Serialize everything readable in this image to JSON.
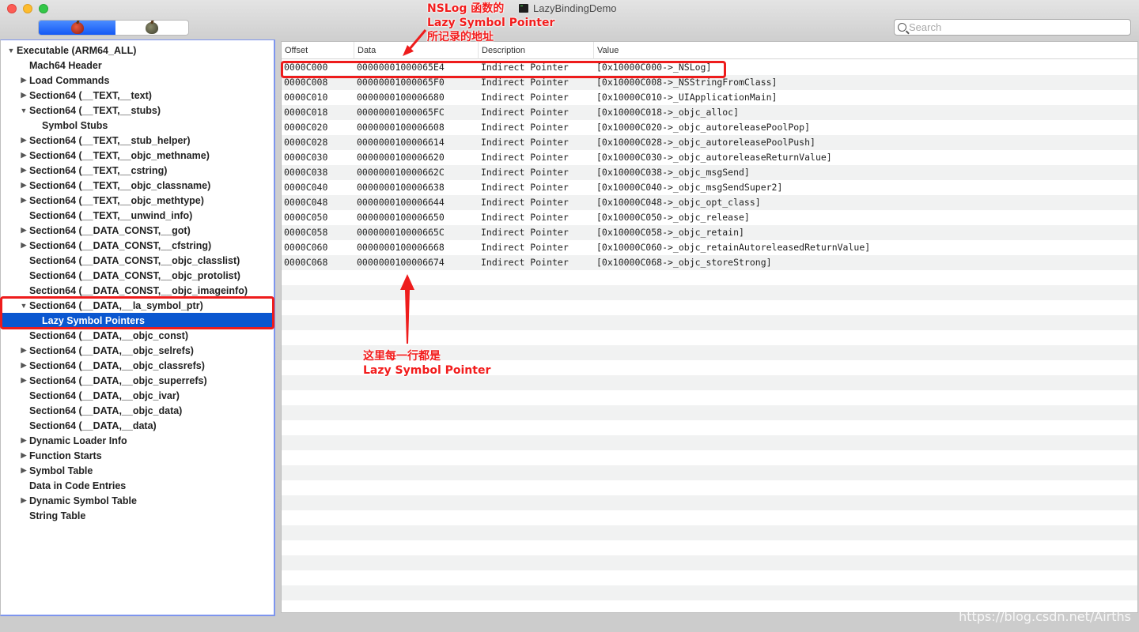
{
  "window": {
    "title": "LazyBindingDemo",
    "search_placeholder": "Search"
  },
  "sidebar": {
    "items": [
      {
        "label": "Executable  (ARM64_ALL)",
        "level": 0,
        "disclosure": "open"
      },
      {
        "label": "Mach64 Header",
        "level": 1,
        "disclosure": "none"
      },
      {
        "label": "Load Commands",
        "level": 1,
        "disclosure": "closed"
      },
      {
        "label": "Section64 (__TEXT,__text)",
        "level": 1,
        "disclosure": "closed"
      },
      {
        "label": "Section64 (__TEXT,__stubs)",
        "level": 1,
        "disclosure": "open"
      },
      {
        "label": "Symbol Stubs",
        "level": 2,
        "disclosure": "none"
      },
      {
        "label": "Section64 (__TEXT,__stub_helper)",
        "level": 1,
        "disclosure": "closed"
      },
      {
        "label": "Section64 (__TEXT,__objc_methname)",
        "level": 1,
        "disclosure": "closed"
      },
      {
        "label": "Section64 (__TEXT,__cstring)",
        "level": 1,
        "disclosure": "closed"
      },
      {
        "label": "Section64 (__TEXT,__objc_classname)",
        "level": 1,
        "disclosure": "closed"
      },
      {
        "label": "Section64 (__TEXT,__objc_methtype)",
        "level": 1,
        "disclosure": "closed"
      },
      {
        "label": "Section64 (__TEXT,__unwind_info)",
        "level": 1,
        "disclosure": "none"
      },
      {
        "label": "Section64 (__DATA_CONST,__got)",
        "level": 1,
        "disclosure": "closed"
      },
      {
        "label": "Section64 (__DATA_CONST,__cfstring)",
        "level": 1,
        "disclosure": "closed"
      },
      {
        "label": "Section64 (__DATA_CONST,__objc_classlist)",
        "level": 1,
        "disclosure": "none"
      },
      {
        "label": "Section64 (__DATA_CONST,__objc_protolist)",
        "level": 1,
        "disclosure": "none"
      },
      {
        "label": "Section64 (__DATA_CONST,__objc_imageinfo)",
        "level": 1,
        "disclosure": "none"
      },
      {
        "label": "Section64 (__DATA,__la_symbol_ptr)",
        "level": 1,
        "disclosure": "open"
      },
      {
        "label": "Lazy Symbol Pointers",
        "level": 2,
        "disclosure": "none",
        "selected": true
      },
      {
        "label": "Section64 (__DATA,__objc_const)",
        "level": 1,
        "disclosure": "none"
      },
      {
        "label": "Section64 (__DATA,__objc_selrefs)",
        "level": 1,
        "disclosure": "closed"
      },
      {
        "label": "Section64 (__DATA,__objc_classrefs)",
        "level": 1,
        "disclosure": "closed"
      },
      {
        "label": "Section64 (__DATA,__objc_superrefs)",
        "level": 1,
        "disclosure": "closed"
      },
      {
        "label": "Section64 (__DATA,__objc_ivar)",
        "level": 1,
        "disclosure": "none"
      },
      {
        "label": "Section64 (__DATA,__objc_data)",
        "level": 1,
        "disclosure": "none"
      },
      {
        "label": "Section64 (__DATA,__data)",
        "level": 1,
        "disclosure": "none"
      },
      {
        "label": "Dynamic Loader Info",
        "level": 1,
        "disclosure": "closed"
      },
      {
        "label": "Function Starts",
        "level": 1,
        "disclosure": "closed"
      },
      {
        "label": "Symbol Table",
        "level": 1,
        "disclosure": "closed"
      },
      {
        "label": "Data in Code Entries",
        "level": 1,
        "disclosure": "none"
      },
      {
        "label": "Dynamic Symbol Table",
        "level": 1,
        "disclosure": "closed"
      },
      {
        "label": "String Table",
        "level": 1,
        "disclosure": "none"
      }
    ]
  },
  "table": {
    "columns": [
      "Offset",
      "Data",
      "Description",
      "Value"
    ],
    "rows": [
      {
        "offset": "0000C000",
        "data": "00000001000065E4",
        "description": "Indirect Pointer",
        "value": "[0x10000C000->_NSLog]"
      },
      {
        "offset": "0000C008",
        "data": "00000001000065F0",
        "description": "Indirect Pointer",
        "value": "[0x10000C008->_NSStringFromClass]"
      },
      {
        "offset": "0000C010",
        "data": "0000000100006680",
        "description": "Indirect Pointer",
        "value": "[0x10000C010->_UIApplicationMain]"
      },
      {
        "offset": "0000C018",
        "data": "00000001000065FC",
        "description": "Indirect Pointer",
        "value": "[0x10000C018->_objc_alloc]"
      },
      {
        "offset": "0000C020",
        "data": "0000000100006608",
        "description": "Indirect Pointer",
        "value": "[0x10000C020->_objc_autoreleasePoolPop]"
      },
      {
        "offset": "0000C028",
        "data": "0000000100006614",
        "description": "Indirect Pointer",
        "value": "[0x10000C028->_objc_autoreleasePoolPush]"
      },
      {
        "offset": "0000C030",
        "data": "0000000100006620",
        "description": "Indirect Pointer",
        "value": "[0x10000C030->_objc_autoreleaseReturnValue]"
      },
      {
        "offset": "0000C038",
        "data": "000000010000662C",
        "description": "Indirect Pointer",
        "value": "[0x10000C038->_objc_msgSend]"
      },
      {
        "offset": "0000C040",
        "data": "0000000100006638",
        "description": "Indirect Pointer",
        "value": "[0x10000C040->_objc_msgSendSuper2]"
      },
      {
        "offset": "0000C048",
        "data": "0000000100006644",
        "description": "Indirect Pointer",
        "value": "[0x10000C048->_objc_opt_class]"
      },
      {
        "offset": "0000C050",
        "data": "0000000100006650",
        "description": "Indirect Pointer",
        "value": "[0x10000C050->_objc_release]"
      },
      {
        "offset": "0000C058",
        "data": "000000010000665C",
        "description": "Indirect Pointer",
        "value": "[0x10000C058->_objc_retain]"
      },
      {
        "offset": "0000C060",
        "data": "0000000100006668",
        "description": "Indirect Pointer",
        "value": "[0x10000C060->_objc_retainAutoreleasedReturnValue]"
      },
      {
        "offset": "0000C068",
        "data": "0000000100006674",
        "description": "Indirect Pointer",
        "value": "[0x10000C068->_objc_storeStrong]"
      }
    ]
  },
  "annotations": {
    "top_note": [
      "NSLog 函数的",
      "Lazy Symbol Pointer",
      "所记录的地址"
    ],
    "bottom_note": [
      "这里每一行都是",
      "Lazy Symbol Pointer"
    ],
    "color": "#ee1c1c"
  },
  "watermark": "https://blog.csdn.net/Airths"
}
